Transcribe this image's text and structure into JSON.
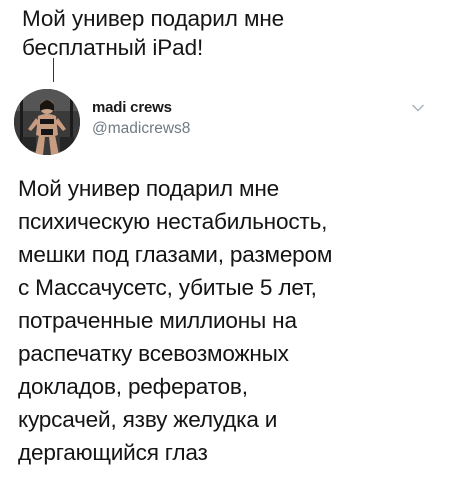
{
  "caption": {
    "line1": "Мой универ подарил мне",
    "line2": "бесплатный iPad!"
  },
  "tweet": {
    "display_name": "madi crews",
    "handle": "@madicrews8",
    "menu_icon": "chevron-down-icon",
    "lines": [
      "Мой универ подарил мне",
      "психическую нестабильность,",
      "мешки под глазами, размером",
      "с Массачусетс, убитые 5 лет,",
      "потраченные миллионы на",
      "распечатку всевозможных",
      "докладов, рефератов,",
      "курсачей, язву желудка и",
      "дергающийся глаз"
    ]
  },
  "colors": {
    "background": "#ffffff",
    "text": "#141414",
    "handle": "#6f7a84"
  }
}
